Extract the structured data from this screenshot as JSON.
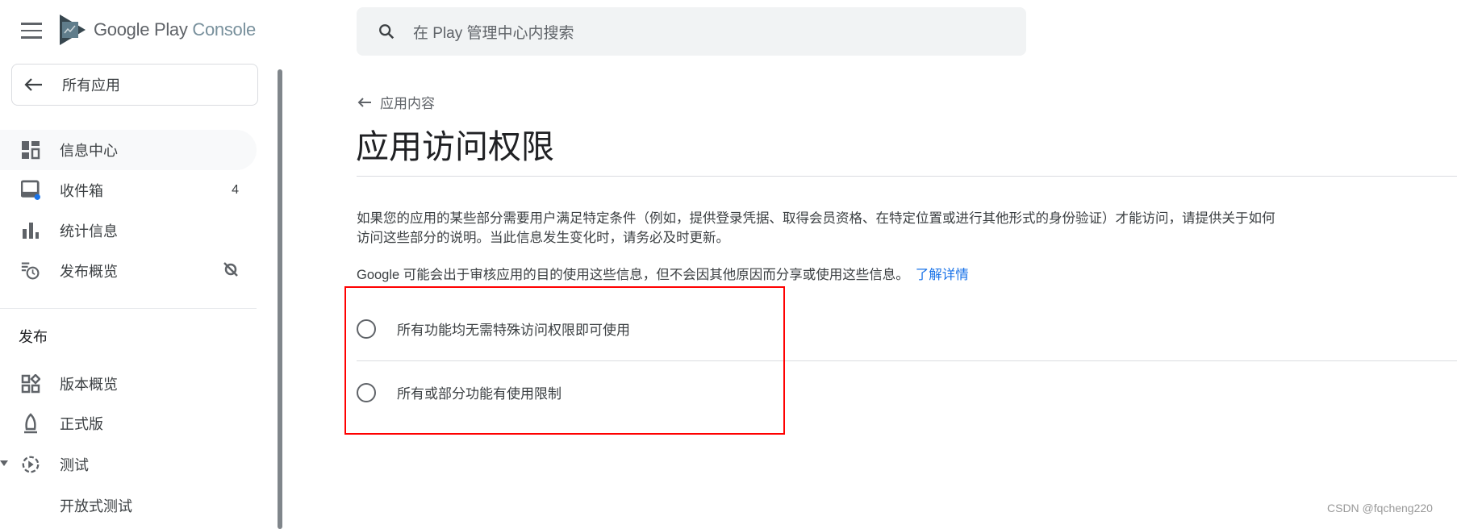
{
  "header": {
    "logo_main": "Google Play",
    "logo_sub": "Console",
    "search_placeholder": "在 Play 管理中心内搜索"
  },
  "sidebar": {
    "all_apps": "所有应用",
    "items": [
      {
        "label": "信息中心",
        "icon": "dashboard-icon"
      },
      {
        "label": "收件箱",
        "icon": "inbox-icon",
        "badge": "4"
      },
      {
        "label": "统计信息",
        "icon": "bar-chart-icon"
      },
      {
        "label": "发布概览",
        "icon": "publishing-overview-icon"
      }
    ],
    "section": "发布",
    "release_items": [
      {
        "label": "版本概览",
        "icon": "release-overview-icon"
      },
      {
        "label": "正式版",
        "icon": "production-icon"
      },
      {
        "label": "测试",
        "icon": "testing-icon"
      },
      {
        "label": "开放式测试"
      }
    ]
  },
  "main": {
    "breadcrumb": "应用内容",
    "title": "应用访问权限",
    "description": "如果您的应用的某些部分需要用户满足特定条件（例如，提供登录凭据、取得会员资格、在特定位置或进行其他形式的身份验证）才能访问，请提供关于如何访问这些部分的说明。当此信息发生变化时，请务必及时更新。",
    "google_note": "Google 可能会出于审核应用的目的使用这些信息，但不会因其他原因而分享或使用这些信息。",
    "learn_more": "了解详情",
    "options": [
      "所有功能均无需特殊访问权限即可使用",
      "所有或部分功能有使用限制"
    ]
  },
  "watermark": "CSDN @fqcheng220"
}
